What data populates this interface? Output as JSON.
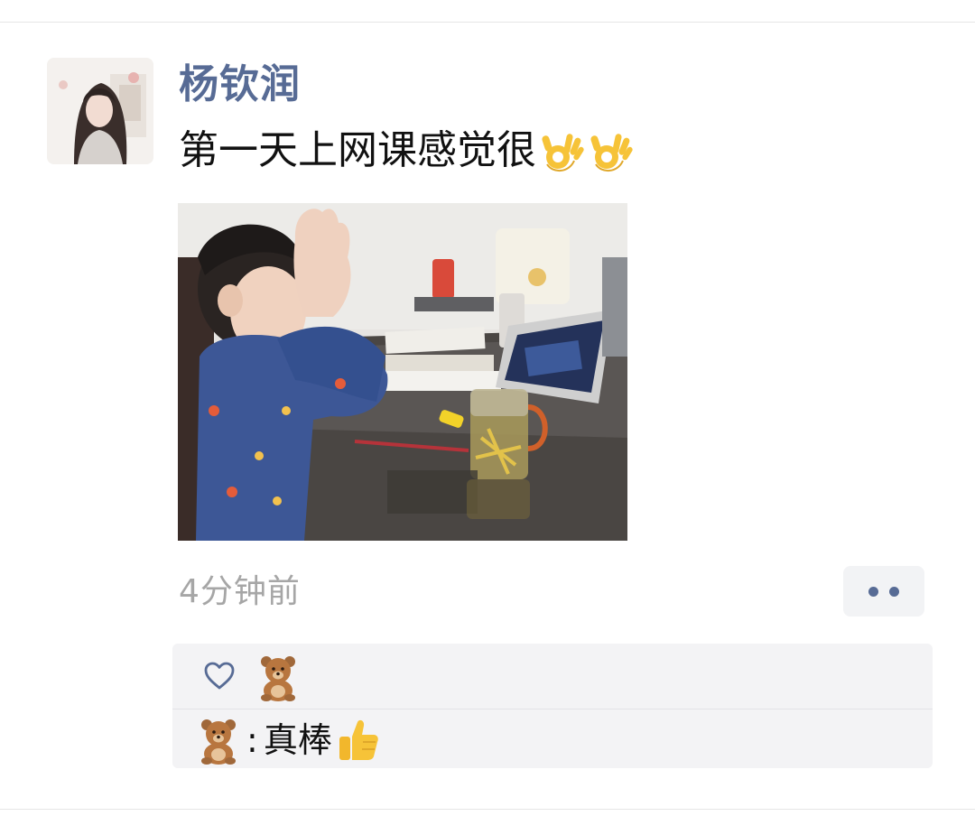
{
  "post": {
    "username": "杨钦润",
    "text": "第一天上网课感觉很",
    "emojis": [
      "ok-hand-icon",
      "ok-hand-icon"
    ],
    "time": "4分钟前"
  },
  "interactions": {
    "likes": [
      "bear-icon"
    ],
    "comments": [
      {
        "author_icon": "bear-icon",
        "separator": ":",
        "text": "真棒",
        "emoji": "thumbs-up-icon"
      }
    ]
  },
  "colors": {
    "name_blue": "#576b95",
    "time_gray": "#a6a6a6",
    "panel_bg": "#f3f3f5",
    "emoji_yellow": "#f6c338"
  }
}
